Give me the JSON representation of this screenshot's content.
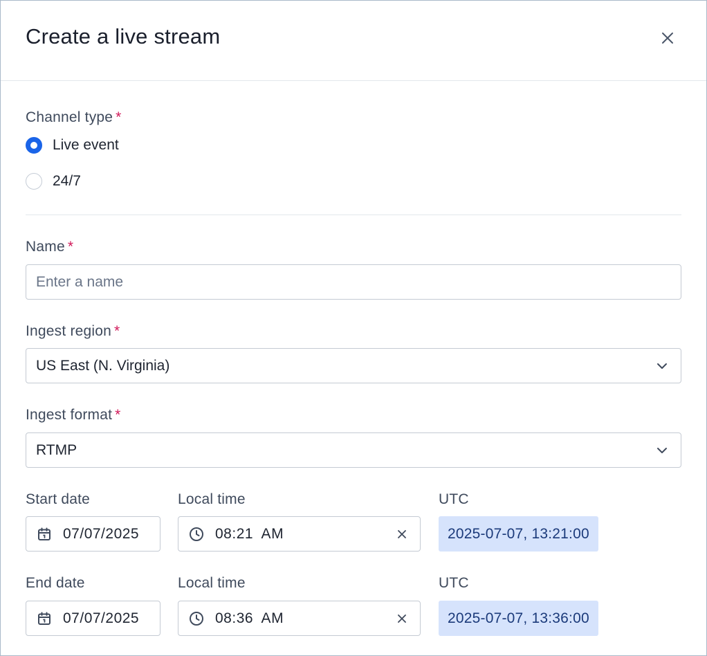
{
  "modal": {
    "title": "Create a live stream",
    "close_icon": "close-icon"
  },
  "channel_type": {
    "label": "Channel type",
    "required_mark": "*",
    "options": [
      {
        "label": "Live event",
        "selected": true
      },
      {
        "label": "24/7",
        "selected": false
      }
    ]
  },
  "name": {
    "label": "Name",
    "required_mark": "*",
    "value": "",
    "placeholder": "Enter a name"
  },
  "ingest_region": {
    "label": "Ingest region",
    "required_mark": "*",
    "value": "US East (N. Virginia)",
    "icon": "chevron-down-icon"
  },
  "ingest_format": {
    "label": "Ingest format",
    "required_mark": "*",
    "value": "RTMP",
    "icon": "chevron-down-icon"
  },
  "start": {
    "date_label": "Start date",
    "date_value": "07/07/2025",
    "date_icon": "calendar-icon",
    "time_label": "Local time",
    "time_value": "08:21  AM",
    "time_icon": "clock-icon",
    "clear_icon": "clear-icon",
    "utc_label": "UTC",
    "utc_value": "2025-07-07, 13:21:00"
  },
  "end": {
    "date_label": "End date",
    "date_value": "07/07/2025",
    "date_icon": "calendar-icon",
    "time_label": "Local time",
    "time_value": "08:36  AM",
    "time_icon": "clock-icon",
    "clear_icon": "clear-icon",
    "utc_label": "UTC",
    "utc_value": "2025-07-07, 13:36:00"
  },
  "colors": {
    "accent": "#1a64e8",
    "required": "#d11a5a",
    "utc_background": "#d6e3fc",
    "utc_text": "#1b3a7a",
    "border": "#c4cad3"
  }
}
